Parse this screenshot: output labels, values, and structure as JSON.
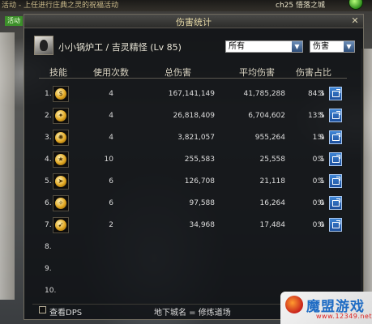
{
  "top_bar": {
    "notice": "活动 - 上任进行庄典之灵的祝福活动",
    "channel": "ch25 悟落之城"
  },
  "left_badge": "活动",
  "window": {
    "title": "伤害统计",
    "character": "小小锅炉工 / 吉灵精怪 (Lv 85)",
    "filter_select": "所有",
    "type_select": "伤害"
  },
  "columns": {
    "skill": "技能",
    "uses": "使用次数",
    "total": "总伤害",
    "avg": "平均伤害",
    "share": "伤害占比"
  },
  "rows": [
    {
      "idx": "1.",
      "icon": "coin-pouch-icon",
      "uses": "4",
      "total": "167,141,149",
      "avg": "41,785,288",
      "share": "84.3",
      "pct": "%"
    },
    {
      "idx": "2.",
      "icon": "flame-strike-icon",
      "uses": "4",
      "total": "26,818,409",
      "avg": "6,704,602",
      "share": "13.5",
      "pct": "%"
    },
    {
      "idx": "3.",
      "icon": "fan-burst-icon",
      "uses": "4",
      "total": "3,821,057",
      "avg": "955,264",
      "share": "1.9",
      "pct": "%"
    },
    {
      "idx": "4.",
      "icon": "star-throw-icon",
      "uses": "10",
      "total": "255,583",
      "avg": "25,558",
      "share": "0.1",
      "pct": "%"
    },
    {
      "idx": "5.",
      "icon": "dash-icon",
      "uses": "6",
      "total": "126,708",
      "avg": "21,118",
      "share": "0.1",
      "pct": "%"
    },
    {
      "idx": "6.",
      "icon": "spin-kick-icon",
      "uses": "6",
      "total": "97,588",
      "avg": "16,264",
      "share": "0.0",
      "pct": "%"
    },
    {
      "idx": "7.",
      "icon": "claw-swipe-icon",
      "uses": "2",
      "total": "34,968",
      "avg": "17,484",
      "share": "0.0",
      "pct": "%"
    },
    {
      "idx": "8."
    },
    {
      "idx": "9."
    },
    {
      "idx": "10."
    }
  ],
  "footer": {
    "show_dps": "查看DPS",
    "dungeon": "地下城名 = 修炼道场"
  },
  "watermark": {
    "name": "魔盟游戏",
    "url": "www.12349.net"
  }
}
